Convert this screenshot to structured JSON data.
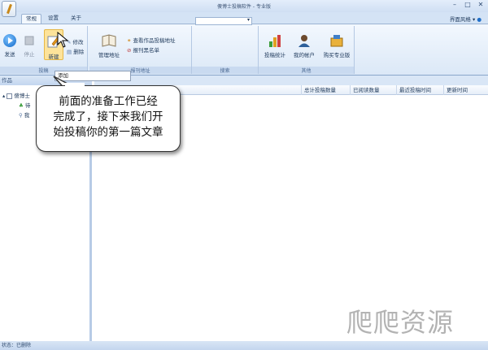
{
  "window": {
    "title": "傻博士投稿软件 - 专业版"
  },
  "tabs": [
    "常规",
    "设置",
    "关于"
  ],
  "ui_style_menu": "界面风格",
  "ribbon": {
    "groups": {
      "submit": "投稿",
      "address": "报刊地址",
      "search": "搜索",
      "other": "其他"
    },
    "buttons": {
      "send": "发送",
      "stop": "停止",
      "new": "新建",
      "edit": "修改",
      "delete": "删除",
      "manage_address": "管理地址",
      "view_address": "查看作品投稿地址",
      "blacklist": "报刊黑名单",
      "stats": "投稿统计",
      "account": "我的帐户",
      "buy": "购买专业版"
    }
  },
  "tooltip": "添加",
  "left_pane": {
    "title": "作品",
    "tree": [
      "傻博士",
      "待",
      "我"
    ]
  },
  "columns": [
    "总计投稿数量",
    "已阅读数量",
    "最近投稿时间",
    "更新时间"
  ],
  "status": "状态：已删除",
  "callout": {
    "line1": "前面的准备工作已经",
    "line2": "完成了，接下来我们开",
    "line3": "始投稿你的第一篇文章"
  },
  "watermark": "爬爬资源"
}
